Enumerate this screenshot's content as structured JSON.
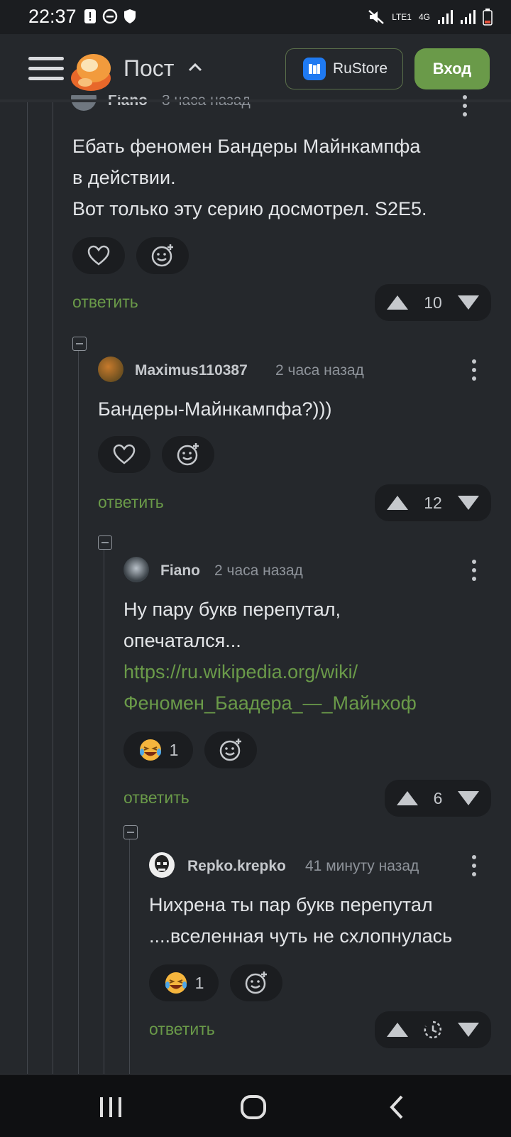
{
  "status_bar": {
    "time": "22:37",
    "network_label": "LTE1",
    "network_type": "4G"
  },
  "header": {
    "menu_icon": "hamburger-icon",
    "title": "Пост",
    "rustore_label": "RuStore",
    "login_label": "Вход"
  },
  "comments": [
    {
      "author": "Fiano",
      "time": "3 часа назад",
      "lines": [
        "Ебать феномен Бандеры Майнкампфа",
        "в действии.",
        "Вот только эту серию досмотрел. S2E5."
      ],
      "reply_label": "ответить",
      "votes": "10"
    },
    {
      "author": "Maximus110387",
      "time": "2 часа назад",
      "lines": [
        "Бандеры-Майнкампфа?)))"
      ],
      "reply_label": "ответить",
      "votes": "12"
    },
    {
      "author": "Fiano",
      "time": "2 часа назад",
      "lines": [
        "Ну пару букв перепутал,",
        "опечатался..."
      ],
      "link_lines": [
        "https://ru.wikipedia.org/wiki/",
        "Феномен_Баадера_—_Майнхоф"
      ],
      "reaction_count": "1",
      "reply_label": "ответить",
      "votes": "6"
    },
    {
      "author": "Repko.krepko",
      "time": "41 минуту назад",
      "lines": [
        "Нихрена ты пар букв перепутал",
        "....вселенная чуть не схлопнулась"
      ],
      "reaction_count": "1",
      "reply_label": "ответить"
    }
  ],
  "colors": {
    "background": "#25282c",
    "accent_green": "#6a9a49",
    "pill_bg": "#1b1d20"
  }
}
